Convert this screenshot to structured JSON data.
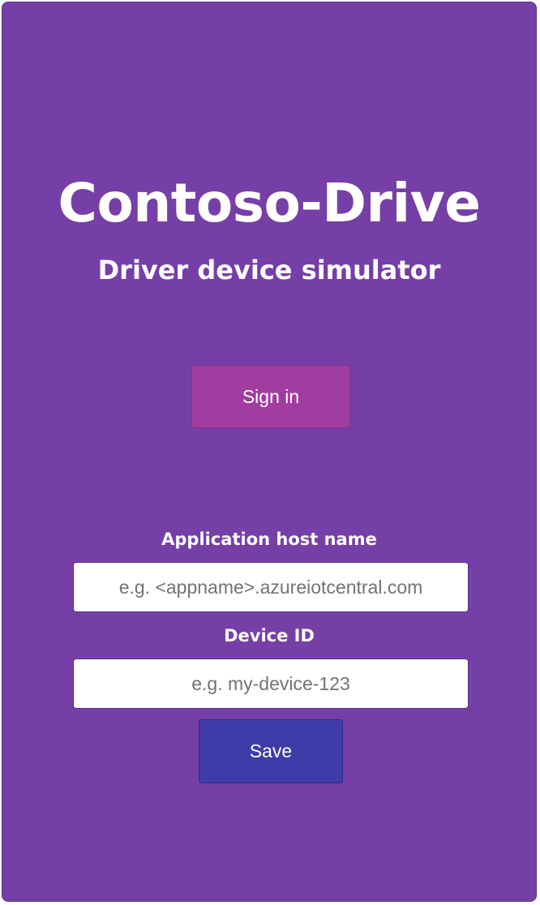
{
  "app": {
    "title": "Contoso-Drive",
    "subtitle": "Driver device simulator"
  },
  "auth": {
    "sign_in_label": "Sign in"
  },
  "form": {
    "host_label": "Application host name",
    "host_placeholder": "e.g. <appname>.azureiotcentral.com",
    "host_value": "",
    "device_label": "Device ID",
    "device_placeholder": "e.g. my-device-123",
    "device_value": "",
    "save_label": "Save"
  },
  "colors": {
    "background": "#763fa7",
    "sign_in_button": "#a33ca1",
    "save_button": "#3d3ca9",
    "text": "#ffffff"
  }
}
